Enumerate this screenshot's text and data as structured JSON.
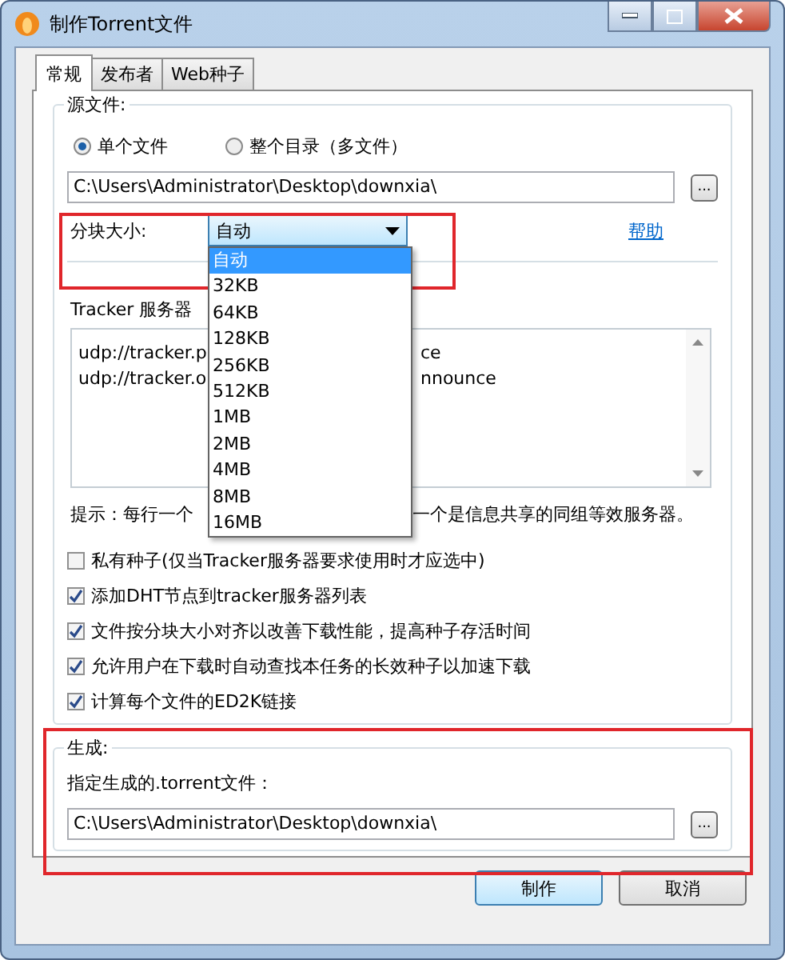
{
  "window": {
    "title": "制作Torrent文件"
  },
  "tabs": [
    {
      "label": "常规",
      "selected": true
    },
    {
      "label": "发布者",
      "selected": false
    },
    {
      "label": "Web种子",
      "selected": false
    }
  ],
  "source": {
    "legend": "源文件:",
    "options": [
      {
        "label": "单个文件",
        "selected": true
      },
      {
        "label": "整个目录（多文件）",
        "selected": false
      }
    ],
    "path": "C:\\Users\\Administrator\\Desktop\\downxia\\",
    "browse": "..."
  },
  "block_size": {
    "label": "分块大小:",
    "value": "自动",
    "help": "帮助",
    "options": [
      {
        "label": "自动",
        "selected": true
      },
      {
        "label": "32KB",
        "selected": false
      },
      {
        "label": "64KB",
        "selected": false
      },
      {
        "label": "128KB",
        "selected": false
      },
      {
        "label": "256KB",
        "selected": false
      },
      {
        "label": "512KB",
        "selected": false
      },
      {
        "label": "1MB",
        "selected": false
      },
      {
        "label": "2MB",
        "selected": false
      },
      {
        "label": "4MB",
        "selected": false
      },
      {
        "label": "8MB",
        "selected": false
      },
      {
        "label": "16MB",
        "selected": false
      }
    ]
  },
  "trackers": {
    "label": "Tracker 服务器",
    "lines": [
      {
        "left": "udp://tracker.p",
        "right": "ce"
      },
      {
        "left": "udp://tracker.o",
        "right": "nnounce"
      }
    ],
    "hint_left": "提示：每行一个",
    "hint_right": "一个是信息共享的同组等效服务器。"
  },
  "options": [
    {
      "label": "私有种子(仅当Tracker服务器要求使用时才应选中)",
      "checked": false
    },
    {
      "label": "添加DHT节点到tracker服务器列表",
      "checked": true
    },
    {
      "label": "文件按分块大小对齐以改善下载性能，提高种子存活时间",
      "checked": true
    },
    {
      "label": "允许用户在下载时自动查找本任务的长效种子以加速下载",
      "checked": true
    },
    {
      "label": "计算每个文件的ED2K链接",
      "checked": true
    }
  ],
  "output": {
    "legend": "生成:",
    "label": "指定生成的.torrent文件：",
    "path": "C:\\Users\\Administrator\\Desktop\\downxia\\",
    "browse": "..."
  },
  "buttons": [
    "制作",
    "取消"
  ]
}
